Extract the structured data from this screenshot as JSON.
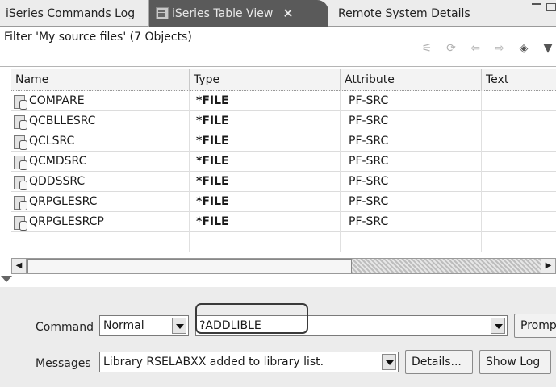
{
  "tabs": [
    {
      "label": "iSeries Commands Log"
    },
    {
      "label": "iSeries Table View",
      "close": "✕"
    },
    {
      "label": "Remote System Details"
    }
  ],
  "filter": {
    "label": "Filter 'My source files' (7 Objects)"
  },
  "table": {
    "columns": [
      "Name",
      "Type",
      "Attribute",
      "Text"
    ],
    "rows": [
      {
        "name": "COMPARE",
        "type": "*FILE",
        "attribute": "PF-SRC",
        "text": ""
      },
      {
        "name": "QCBLLESRC",
        "type": "*FILE",
        "attribute": "PF-SRC",
        "text": ""
      },
      {
        "name": "QCLSRC",
        "type": "*FILE",
        "attribute": "PF-SRC",
        "text": ""
      },
      {
        "name": "QCMDSRC",
        "type": "*FILE",
        "attribute": "PF-SRC",
        "text": ""
      },
      {
        "name": "QDDSSRC",
        "type": "*FILE",
        "attribute": "PF-SRC",
        "text": ""
      },
      {
        "name": "QRPGLESRC",
        "type": "*FILE",
        "attribute": "PF-SRC",
        "text": ""
      },
      {
        "name": "QRPGLESRCP",
        "type": "*FILE",
        "attribute": "PF-SRC",
        "text": ""
      }
    ]
  },
  "command": {
    "label": "Command",
    "mode": "Normal",
    "value": "?ADDLIBLE",
    "prompt_label": "Prompt"
  },
  "messages": {
    "label": "Messages",
    "value": "Library RSELABXX added to library list.",
    "details_label": "Details...",
    "show_log_label": "Show Log"
  },
  "toolbar_icons": [
    "filter-icon",
    "refresh-icon",
    "back-icon",
    "forward-icon",
    "view-menu-icon",
    "dropdown-menu-icon"
  ]
}
